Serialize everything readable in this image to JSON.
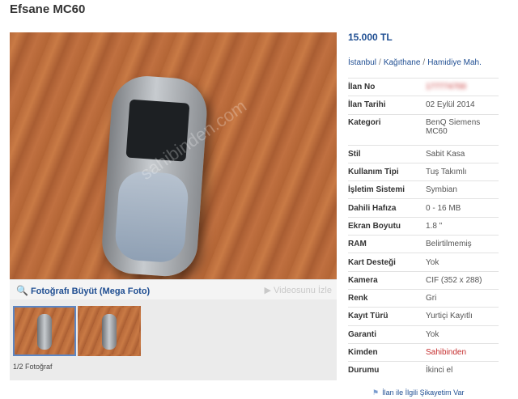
{
  "listing": {
    "title": "Efsane MC60"
  },
  "gallery": {
    "mega_photo_label": "Fotoğrafı Büyüt (Mega Foto)",
    "video_label": "Videosunu İzle",
    "photo_count": "1/2 Fotoğraf",
    "watermark": "sahibinden.com"
  },
  "summary": {
    "price": "15.000 TL",
    "location": [
      "İstanbul",
      "Kağıthane",
      "Hamidiye Mah."
    ],
    "location_sep": "/"
  },
  "details": [
    {
      "label": "İlan No",
      "value": "177774700"
    },
    {
      "label": "İlan Tarihi",
      "value": "02 Eylül 2014"
    },
    {
      "label": "Kategori",
      "value": "BenQ Siemens MC60"
    },
    {
      "label": "Stil",
      "value": "Sabit Kasa"
    },
    {
      "label": "Kullanım Tipi",
      "value": "Tuş Takımlı"
    },
    {
      "label": "İşletim Sistemi",
      "value": "Symbian"
    },
    {
      "label": "Dahili Hafıza",
      "value": "0 - 16 MB"
    },
    {
      "label": "Ekran Boyutu",
      "value": "1.8 \""
    },
    {
      "label": "RAM",
      "value": "Belirtilmemiş"
    },
    {
      "label": "Kart Desteği",
      "value": "Yok"
    },
    {
      "label": "Kamera",
      "value": "CIF (352 x 288)"
    },
    {
      "label": "Renk",
      "value": "Gri"
    },
    {
      "label": "Kayıt Türü",
      "value": "Yurtiçi Kayıtlı"
    },
    {
      "label": "Garanti",
      "value": "Yok"
    },
    {
      "label": "Kimden",
      "value": "Sahibinden"
    },
    {
      "label": "Durumu",
      "value": "İkinci el"
    }
  ],
  "complaint_link": "İlan ile İlgili Şikayetim Var",
  "colors": {
    "link_blue": "#1f4e92",
    "seller_red": "#c52d2d"
  }
}
